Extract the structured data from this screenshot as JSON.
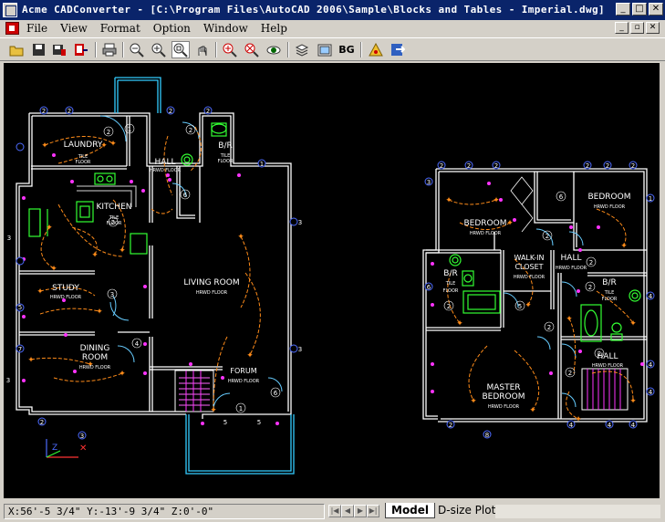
{
  "window": {
    "title": "Acme CADConverter - [C:\\Program Files\\AutoCAD 2006\\Sample\\Blocks and Tables - Imperial.dwg]",
    "controls": [
      "_",
      "□",
      "✕"
    ]
  },
  "menubar": {
    "items": [
      "File",
      "View",
      "Format",
      "Option",
      "Window",
      "Help"
    ],
    "mdi_controls": [
      "_",
      "▫",
      "✕"
    ]
  },
  "toolbar": {
    "bg_label": "BG"
  },
  "drawing": {
    "rooms": {
      "laundry": "LAUNDRY",
      "kitchen": "KITCHEN",
      "study": "STUDY",
      "dining1": "DINING",
      "dining2": "ROOM",
      "living": "LIVING ROOM",
      "forum": "FORUM",
      "hall1": "HALL",
      "br1": "B/R",
      "bedroom1": "BEDROOM",
      "bedroom2": "BEDROOM",
      "walkin1": "WALK-IN",
      "walkin2": "CLOSET",
      "br2": "B/R",
      "br3": "B/R",
      "hall2": "HALL",
      "hall3": "HALL",
      "master1": "MASTER",
      "master2": "BEDROOM"
    },
    "floors": {
      "tile": "TILE",
      "floor": "FLOOR",
      "hrwd": "HRWD FLOOR",
      "hardwood": "HARDWOOD FLOOR"
    }
  },
  "status": {
    "coords": "X:56'-5 3/4\" Y:-13'-9 3/4\" Z:0'-0\"",
    "tabs": [
      "Model",
      "D-size Plot"
    ]
  },
  "colors": {
    "wall": "#ffffff",
    "wire": "#ff8c1a",
    "symbol": "#ff33ff",
    "fixture": "#33ff33",
    "door": "#33ccff",
    "accent": "#0a246a"
  }
}
